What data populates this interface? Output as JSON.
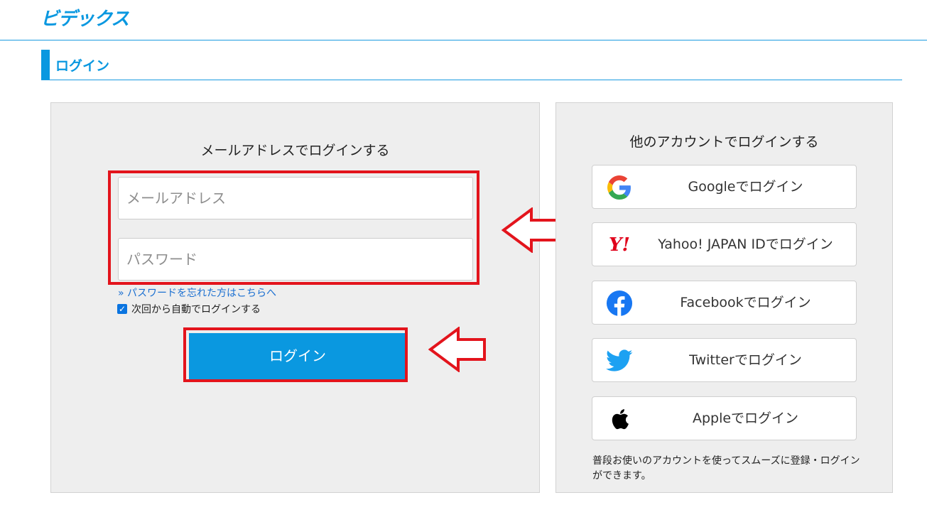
{
  "header": {
    "logo": "ビデックス"
  },
  "section": {
    "title": "ログイン"
  },
  "left_panel": {
    "heading": "メールアドレスでログインする",
    "email_placeholder": "メールアドレス",
    "password_placeholder": "パスワード",
    "forgot_link": "» パスワードを忘れた方はこちらへ",
    "remember_label": "次回から自動でログインする",
    "remember_checked": true,
    "login_button": "ログイン"
  },
  "right_panel": {
    "heading": "他のアカウントでログインする",
    "buttons": [
      {
        "label": "Googleでログイン",
        "icon": "google-icon"
      },
      {
        "label": "Yahoo! JAPAN IDでログイン",
        "icon": "yahoo-japan-icon"
      },
      {
        "label": "Facebookでログイン",
        "icon": "facebook-icon"
      },
      {
        "label": "Twitterでログイン",
        "icon": "twitter-icon"
      },
      {
        "label": "Appleでログイン",
        "icon": "apple-icon"
      }
    ],
    "note": "普段お使いのアカウントを使ってスムーズに登録・ログインができます。",
    "yahoo_logo_text": "Y!"
  },
  "colors": {
    "brand": "#0a98e0",
    "annotation_red": "#e3141c",
    "panel_bg": "#eeeeee",
    "link": "#1a6fd1"
  }
}
